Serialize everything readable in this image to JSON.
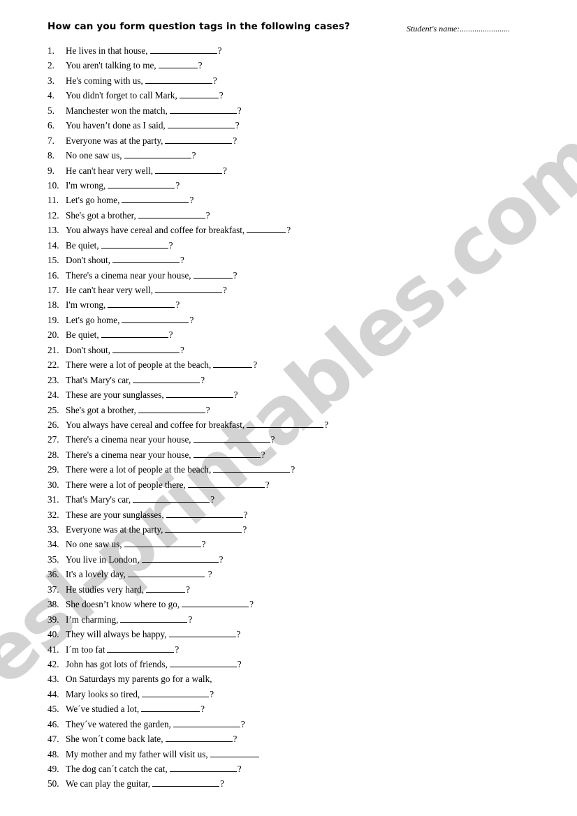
{
  "header": {
    "title": "How can you form question tags in the following cases?",
    "student_name_label": "Student's name:........................"
  },
  "watermark": {
    "text": "esl-printables.com",
    "color": "#d3d3d3"
  },
  "questions": [
    {
      "num": "1.",
      "text": "He lives in that house,",
      "blank": 96,
      "mark": "?",
      "gap": false
    },
    {
      "num": "2.",
      "text": "You aren't talking to me,",
      "blank": 56,
      "mark": "?",
      "gap": false
    },
    {
      "num": "3.",
      "text": "He's coming with us,",
      "blank": 96,
      "mark": "?",
      "gap": false
    },
    {
      "num": "4.",
      "text": "You didn't forget to call Mark,",
      "blank": 56,
      "mark": "?",
      "gap": false
    },
    {
      "num": "5.",
      "text": "Manchester won the match,",
      "blank": 96,
      "mark": "?",
      "gap": false
    },
    {
      "num": "6.",
      "text": "You haven’t done as I said,",
      "blank": 96,
      "mark": "?",
      "gap": false
    },
    {
      "num": "7.",
      "text": "Everyone was at the party,",
      "blank": 96,
      "mark": "?",
      "gap": false
    },
    {
      "num": "8.",
      "text": "No one saw us,",
      "blank": 96,
      "mark": "?",
      "gap": false
    },
    {
      "num": "9.",
      "text": "He can't hear very well,",
      "blank": 96,
      "mark": "?",
      "gap": false
    },
    {
      "num": "10.",
      "text": "I'm wrong,",
      "blank": 96,
      "mark": "?",
      "gap": false
    },
    {
      "num": "11.",
      "text": "Let's go home,",
      "blank": 96,
      "mark": "?",
      "gap": false
    },
    {
      "num": "12.",
      "text": "She's got a brother,",
      "blank": 96,
      "mark": "?",
      "gap": false
    },
    {
      "num": "13.",
      "text": "You always have cereal and coffee for breakfast,",
      "blank": 56,
      "mark": "?",
      "gap": false
    },
    {
      "num": "14.",
      "text": "Be quiet,",
      "blank": 96,
      "mark": "?",
      "gap": false
    },
    {
      "num": "15.",
      "text": "Don't shout,",
      "blank": 96,
      "mark": "?",
      "gap": false
    },
    {
      "num": "16.",
      "text": "There's a cinema near your house,",
      "blank": 56,
      "mark": "?",
      "gap": false
    },
    {
      "num": "17.",
      "text": "He can't hear very well,",
      "blank": 96,
      "mark": "?",
      "gap": false
    },
    {
      "num": "18.",
      "text": "I'm wrong,",
      "blank": 96,
      "mark": "?",
      "gap": false
    },
    {
      "num": "19.",
      "text": "Let's go home,",
      "blank": 96,
      "mark": "?",
      "gap": false
    },
    {
      "num": "20.",
      "text": "Be quiet,",
      "blank": 96,
      "mark": "?",
      "gap": false
    },
    {
      "num": "21.",
      "text": "Don't shout,",
      "blank": 96,
      "mark": "?",
      "gap": false
    },
    {
      "num": "22.",
      "text": "There were a lot of people at the beach,",
      "blank": 56,
      "mark": "?",
      "gap": false
    },
    {
      "num": "23.",
      "text": "That's Mary's car,",
      "blank": 96,
      "mark": "?",
      "gap": false
    },
    {
      "num": "24.",
      "text": "These are your sunglasses,",
      "blank": 96,
      "mark": "?",
      "gap": false
    },
    {
      "num": "25.",
      "text": "She's got a brother,",
      "blank": 96,
      "mark": "?",
      "gap": false
    },
    {
      "num": "26.",
      "text": "You always have cereal and coffee for breakfast,",
      "blank": 110,
      "mark": "?",
      "gap": false
    },
    {
      "num": "27.",
      "text": "There's a cinema near your house,",
      "blank": 110,
      "mark": "?",
      "gap": false
    },
    {
      "num": "28.",
      "text": "There's a cinema near your house,",
      "blank": 96,
      "mark": "?",
      "gap": false
    },
    {
      "num": "29.",
      "text": "There were a lot of people at the beach,",
      "blank": 110,
      "mark": "?",
      "gap": false
    },
    {
      "num": "30.",
      "text": "There were a lot of people there,",
      "blank": 110,
      "mark": "?",
      "gap": false
    },
    {
      "num": "31.",
      "text": "That's Mary's car,",
      "blank": 110,
      "mark": "?",
      "gap": false
    },
    {
      "num": "32.",
      "text": "These are your sunglasses,",
      "blank": 110,
      "mark": "?",
      "gap": false
    },
    {
      "num": "33.",
      "text": "Everyone was at the party,",
      "blank": 110,
      "mark": "?",
      "gap": false
    },
    {
      "num": "34.",
      "text": "No one saw us,",
      "blank": 110,
      "mark": "?",
      "gap": false
    },
    {
      "num": "35.",
      "text": "You live in London,",
      "blank": 110,
      "mark": "?",
      "gap": false
    },
    {
      "num": "36.",
      "text": "It's a lovely day,",
      "blank": 110,
      "mark": "?",
      "gap": true
    },
    {
      "num": "37.",
      "text": "He studies very hard,",
      "blank": 56,
      "mark": "?",
      "gap": false
    },
    {
      "num": "38.",
      "text": "She doesn’t know where to go,",
      "blank": 96,
      "mark": "?",
      "gap": false
    },
    {
      "num": "39.",
      "text": "I’m charming,",
      "blank": 96,
      "mark": "?",
      "gap": false
    },
    {
      "num": "40.",
      "text": "They will always be happy,",
      "blank": 96,
      "mark": "?",
      "gap": false
    },
    {
      "num": "41.",
      "text": "I´m too fat",
      "blank": 96,
      "mark": "?",
      "gap": false
    },
    {
      "num": "42.",
      "text": "John has got lots of friends,",
      "blank": 96,
      "mark": "?",
      "gap": false
    },
    {
      "num": "43.",
      "text": "On Saturdays my parents go for a walk,",
      "blank": 0,
      "mark": "",
      "gap": false
    },
    {
      "num": "44.",
      "text": "Mary looks so tired,",
      "blank": 96,
      "mark": "?",
      "gap": false
    },
    {
      "num": "45.",
      "text": "We´ve studied a lot,",
      "blank": 84,
      "mark": "?",
      "gap": false
    },
    {
      "num": "46.",
      "text": "They´ve watered the garden,",
      "blank": 96,
      "mark": "?",
      "gap": false
    },
    {
      "num": "47.",
      "text": "She won´t come back late,",
      "blank": 96,
      "mark": "?",
      "gap": false
    },
    {
      "num": "48.",
      "text": "My mother and my father will visit us,",
      "blank": 70,
      "mark": "",
      "gap": false
    },
    {
      "num": "49.",
      "text": "The dog can´t catch the cat,",
      "blank": 96,
      "mark": "?",
      "gap": false
    },
    {
      "num": "50.",
      "text": "We can play the guitar,",
      "blank": 96,
      "mark": "?",
      "gap": false
    }
  ]
}
